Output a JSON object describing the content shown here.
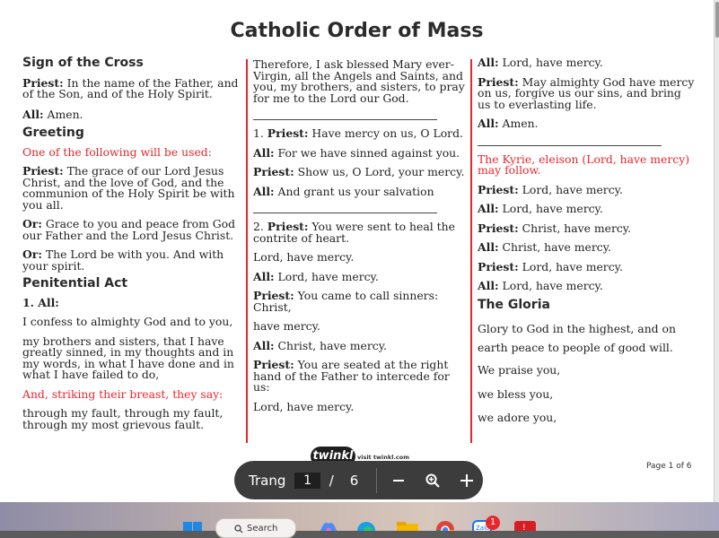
{
  "document": {
    "title": "Catholic Order of Mass",
    "page_label": "Page 1 of 6",
    "logo_text": "twinkl",
    "logo_url": "visit twinkl.com"
  },
  "col1": {
    "h_sign": "Sign of the Cross",
    "p1_b": "Priest:",
    "p1_t": " In the name of the Father, and of the Son, and of the Holy Spirit.",
    "p2_b": "All:",
    "p2_t": " Amen.",
    "h_greeting": "Greeting",
    "red1": "One of the following will be used:",
    "p3_b": "Priest:",
    "p3_t": " The grace of our Lord Jesus Christ, and the love of God, and the communion of the Holy Spirit be with you all.",
    "p4_b": "Or:",
    "p4_t": " Grace to you and peace from God our Father and the Lord Jesus Christ.",
    "p5_b": "Or:",
    "p5_t": " The Lord be with you. And with your spirit.",
    "h_penitential": "Penitential Act",
    "p6_b": "1. All:",
    "p7": "I confess to almighty God and to you,",
    "p8": "my brothers and sisters, that I have greatly sinned, in my thoughts and in my words, in what I have done and in what I have failed to do,",
    "red2": "And, striking their breast, they say:",
    "p9": "through my fault, through my fault, through my most grievous fault."
  },
  "col2": {
    "p1": "Therefore, I ask blessed Mary ever-Virgin, all the Angels and Saints, and you, my brothers, and sisters, to pray for me to the Lord our God.",
    "p2_n": "1. ",
    "p2_b": "Priest:",
    "p2_t": " Have mercy on us, O Lord.",
    "p3_b": "All:",
    "p3_t": " For we have sinned against you.",
    "p4_b": "Priest:",
    "p4_t": " Show us, O Lord, your mercy.",
    "p5_b": "All:",
    "p5_t": " And grant us your salvation",
    "p6_n": "2. ",
    "p6_b": "Priest:",
    "p6_t": " You were sent to heal the contrite of heart.",
    "p7": "Lord, have mercy.",
    "p8_b": "All:",
    "p8_t": " Lord, have mercy.",
    "p9_b": "Priest:",
    "p9_t": " You came to call sinners: Christ,",
    "p10": "have mercy.",
    "p11_b": "All:",
    "p11_t": " Christ, have mercy.",
    "p12_b": "Priest:",
    "p12_t": " You are seated at the right hand of the Father to intercede for us:",
    "p13": "Lord, have mercy."
  },
  "col3": {
    "p1_b": "All:",
    "p1_t": " Lord, have mercy.",
    "p2_b": "Priest:",
    "p2_t": " May almighty God have mercy on us, forgive us our sins, and bring us to everlasting life.",
    "p3_b": "All:",
    "p3_t": " Amen.",
    "red1": "The Kyrie, eleison (Lord, have mercy) may follow.",
    "p4_b": "Priest:",
    "p4_t": " Lord, have mercy.",
    "p5_b": "All:",
    "p5_t": " Lord, have mercy.",
    "p6_b": "Priest:",
    "p6_t": " Christ, have mercy.",
    "p7_b": "All:",
    "p7_t": " Christ, have mercy.",
    "p8_b": "Priest:",
    "p8_t": " Lord, have mercy.",
    "p9_b": "All:",
    "p9_t": " Lord, have mercy.",
    "h_gloria": "The Gloria",
    "p10": "Glory to God in the highest, and on earth peace to people of good will.",
    "p11": "We praise you,",
    "p12": "we bless you,",
    "p13": "we adore you,"
  },
  "viewer_toolbar": {
    "page_label": "Trang",
    "current_page": "1",
    "separator": "/",
    "total_pages": "6",
    "zoom_out": "−",
    "zoom_in": "+"
  },
  "taskbar": {
    "search_placeholder": "Search",
    "notification_count": "1"
  },
  "colors": {
    "accent_red": "#e8262b",
    "toolbar_bg": "#3c3c3c"
  }
}
